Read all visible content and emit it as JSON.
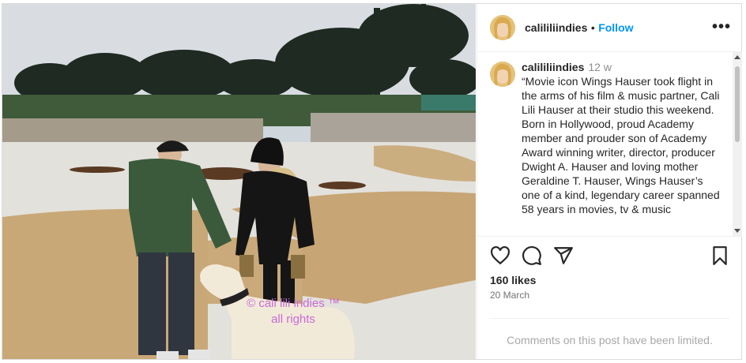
{
  "post": {
    "username": "calililiindies",
    "dot": "•",
    "follow_label": "Follow",
    "more_icon": "•••",
    "watermark": "© cali lili indies ™\nall rights"
  },
  "caption": {
    "username": "calililiindies",
    "time": "12 w",
    "text": "“Movie icon Wings Hauser took flight in the arms of his film & music partner, Cali Lili Hauser at their studio this weekend.\nBorn in Hollywood, proud Academy member and prouder son of Academy Award winning writer, director, producer Dwight A. Hauser and loving mother Geraldine T. Hauser, Wings Hauser’s one of a kind, legendary career spanned 58 years in movies, tv & music"
  },
  "actions": {
    "icons": [
      "heart-icon",
      "comment-icon",
      "share-icon",
      "bookmark-icon"
    ]
  },
  "likes": "160 likes",
  "date": "20 March",
  "comments_notice": "Comments on this post have been limited."
}
